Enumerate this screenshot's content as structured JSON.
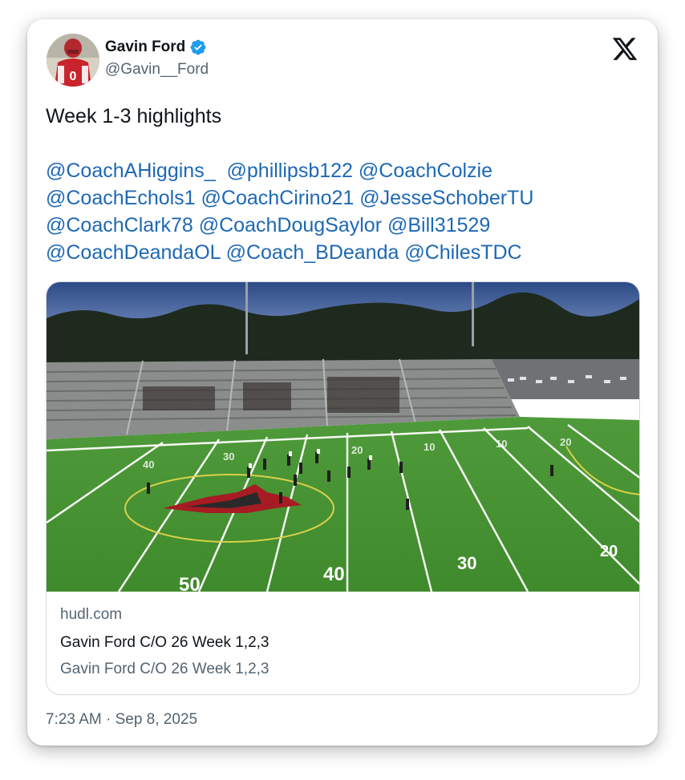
{
  "author": {
    "name": "Gavin Ford",
    "handle": "@Gavin__Ford",
    "verified": true,
    "jersey_number": "0"
  },
  "tweet": {
    "text": "Week 1-3 highlights",
    "mentions": [
      "@CoachAHiggins_",
      "@phillipsb122",
      "@CoachColzie",
      "@CoachEchols1",
      "@CoachCirino21",
      "@JesseSchoberTU",
      "@CoachClark78",
      "@CoachDougSaylor",
      "@Bill31529",
      "@CoachDeandaOL",
      "@Coach_BDeanda",
      "@ChilesTDC"
    ]
  },
  "link_card": {
    "domain": "hudl.com",
    "title": "Gavin Ford C/O 26 Week 1,2,3",
    "description": "Gavin Ford C/O 26 Week 1,2,3",
    "field_numbers": [
      "50",
      "40",
      "30",
      "20",
      "40",
      "30",
      "20",
      "10",
      "10",
      "20"
    ]
  },
  "timestamp": "7:23 AM · Sep 8, 2025",
  "colors": {
    "mention": "#1d68b5",
    "verified": "#1d9bf0",
    "text": "#0f1419",
    "secondary": "#536471"
  },
  "icons": {
    "brand": "x-logo-icon",
    "verified": "verified-badge-icon"
  }
}
